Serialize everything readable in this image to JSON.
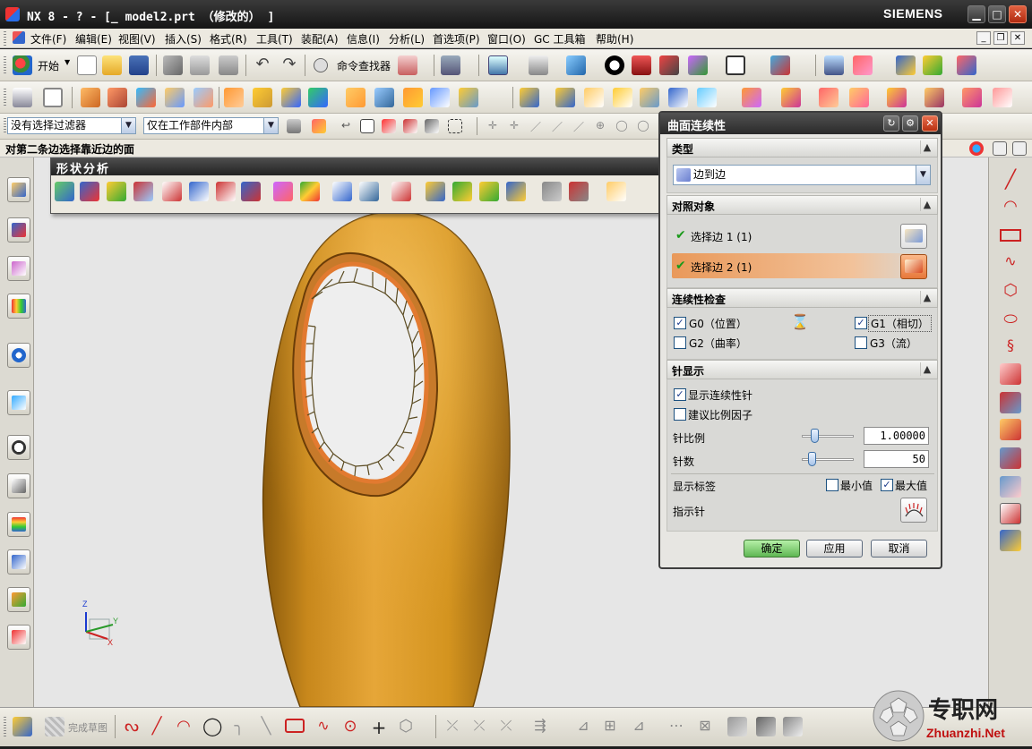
{
  "window": {
    "title": "NX 8 - ? - [_ model2.prt （修改的） ]",
    "brand": "SIEMENS"
  },
  "menubar": {
    "items": [
      "文件(F)",
      "编辑(E)",
      "视图(V)",
      "插入(S)",
      "格式(R)",
      "工具(T)",
      "装配(A)",
      "信息(I)",
      "分析(L)",
      "首选项(P)",
      "窗口(O)",
      "GC 工具箱",
      "帮助(H)"
    ]
  },
  "toolbar1": {
    "start_label": "开始",
    "command_finder_label": "命令查找器"
  },
  "filterbar": {
    "type_filter_value": "没有选择过滤器",
    "scope_filter_value": "仅在工作部件内部"
  },
  "status": {
    "prompt": "对第二条边选择靠近边的面"
  },
  "shape_panel": {
    "title": "形状分析"
  },
  "bottombar": {
    "finish_sketch_label": "完成草图"
  },
  "viewport": {
    "triad_z": "Z",
    "triad_y": "Y",
    "triad_x": "X",
    "model_color": "#d99a2a",
    "inner_ring_color": "#e98a3c"
  },
  "dialog": {
    "title": "曲面连续性",
    "type": {
      "header": "类型",
      "value": "边到边"
    },
    "objects": {
      "header": "对照对象",
      "edge1": "选择边 1 (1)",
      "edge2": "选择边 2 (1)"
    },
    "continuity": {
      "header": "连续性检查",
      "g0": "G0（位置）",
      "g1": "G1（相切）",
      "g2": "G2（曲率）",
      "g3": "G3（流）",
      "g0_checked": true,
      "g1_checked": true,
      "g2_checked": false,
      "g3_checked": false
    },
    "needle": {
      "header": "针显示",
      "show_needles": "显示连续性针",
      "show_needles_checked": true,
      "suggest_scale": "建议比例因子",
      "suggest_scale_checked": false,
      "scale_label": "针比例",
      "scale_value": "1.00000",
      "count_label": "针数",
      "count_value": "50",
      "show_labels": "显示标签",
      "min_label": "最小值",
      "min_checked": false,
      "max_label": "最大值",
      "max_checked": true,
      "pointer_label": "指示针"
    },
    "buttons": {
      "ok": "确定",
      "apply": "应用",
      "cancel": "取消"
    }
  },
  "watermark": {
    "text_cn": "专职网",
    "text_en": "Zhuanzhi.Net"
  }
}
